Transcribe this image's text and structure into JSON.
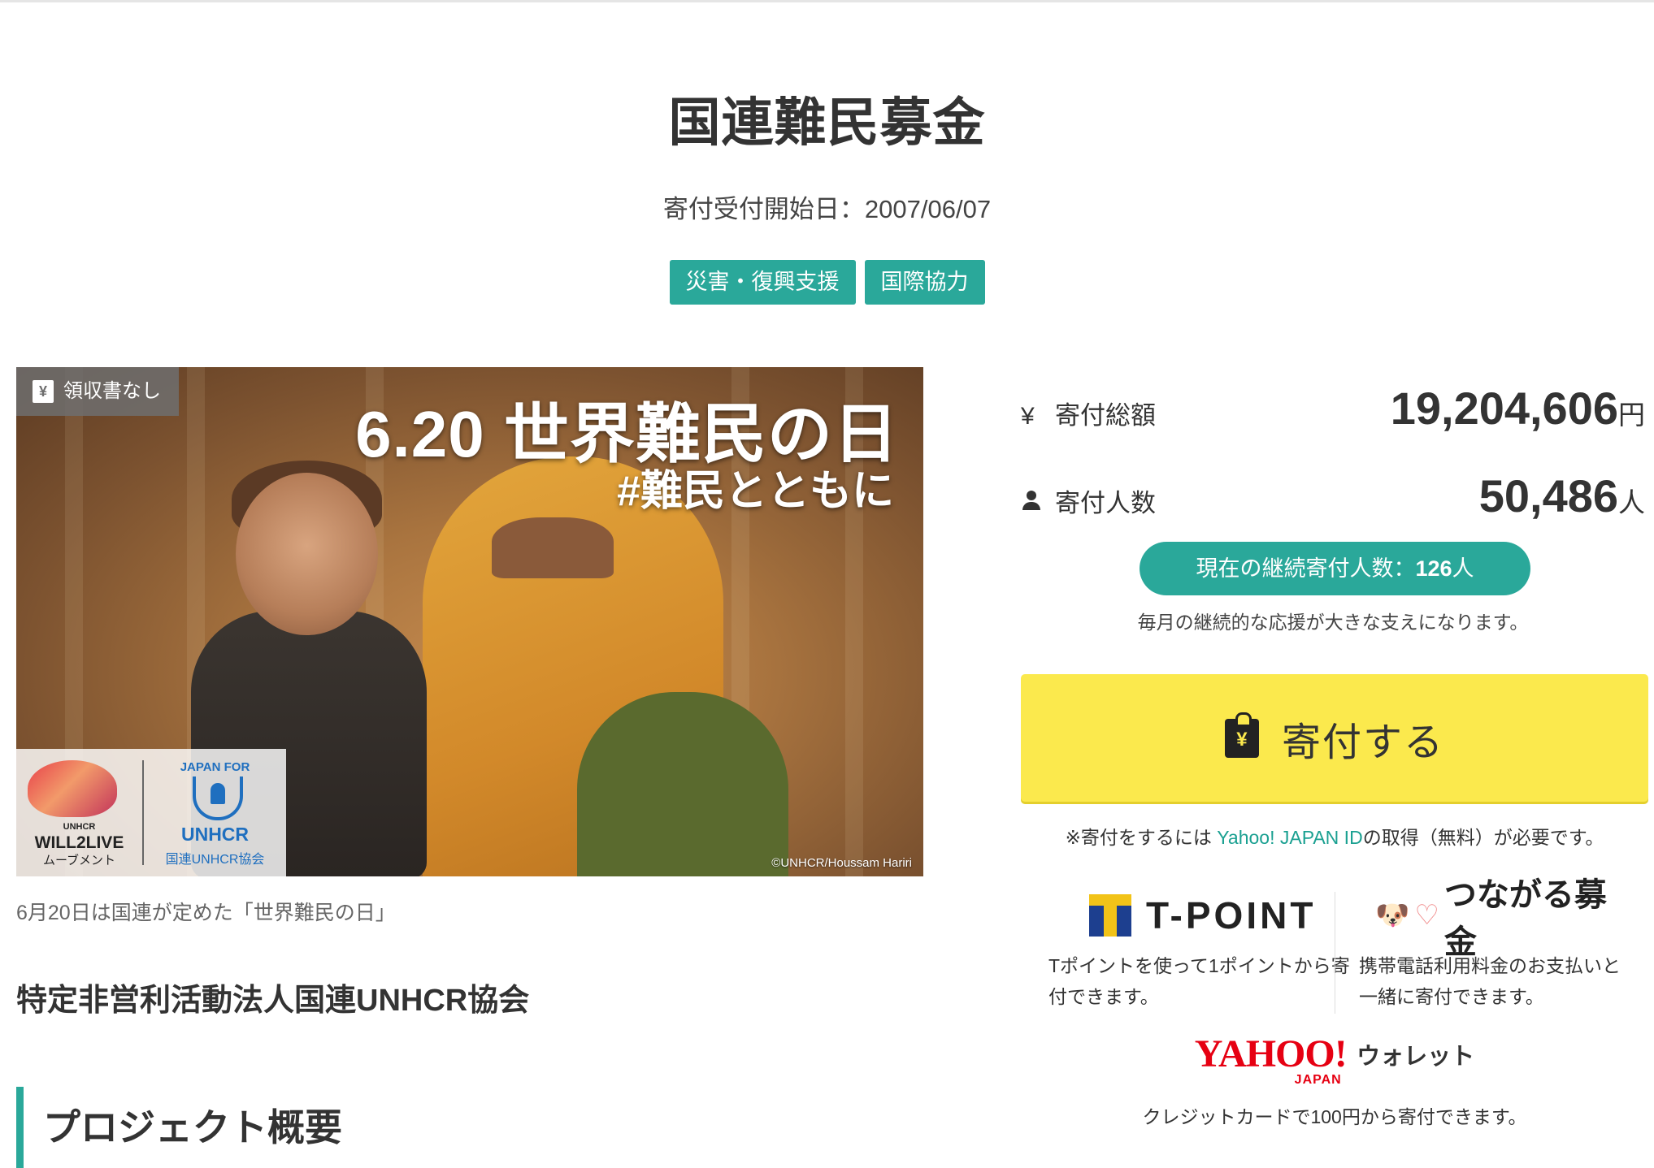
{
  "page": {
    "title": "国連難民募金",
    "start_date": "寄付受付開始日：2007/06/07",
    "tags": [
      "災害・復興支援",
      "国際協力"
    ]
  },
  "hero": {
    "badge_icon": "yen-receipt-icon",
    "badge_symbol": "¥",
    "badge_label": "領収書なし",
    "heading": "6.20 世界難民の日",
    "hashtag": "#難民とともに",
    "credit": "©UNHCR/Houssam Hariri",
    "logo_will_top": "UNHCR",
    "logo_will_name": "WILL2LIVE",
    "logo_will_sub": "ムーブメント",
    "logo_unhcr_top": "JAPAN FOR",
    "logo_unhcr_name": "UNHCR",
    "logo_unhcr_sub": "国連UNHCR協会",
    "caption": "6月20日は国連が定めた「世界難民の日」"
  },
  "org": {
    "name": "特定非営利活動法人国連UNHCR協会"
  },
  "section": {
    "overview_title": "プロジェクト概要"
  },
  "stats": {
    "total_icon": "yen-icon",
    "total_symbol": "¥",
    "total_label": "寄付総額",
    "total_value": "19,204,606",
    "total_unit": "円",
    "donors_icon": "person-icon",
    "donors_label": "寄付人数",
    "donors_value": "50,486",
    "donors_unit": "人",
    "monthly_label": "現在の継続寄付人数：",
    "monthly_value": "126",
    "monthly_unit": "人",
    "monthly_note": "毎月の継続的な応援が大きな支えになります。"
  },
  "donate": {
    "icon": "donation-clipboard-icon",
    "symbol": "¥",
    "label": "寄付する",
    "note_prefix": "※寄付をするには ",
    "note_link": "Yahoo! JAPAN ID",
    "note_suffix": "の取得（無料）が必要です。"
  },
  "payments": {
    "tpoint_logo": "T-POINT",
    "tpoint_desc": "Tポイントを使って1ポイントから寄付できます。",
    "tsunagaru_logo": "つながる募金",
    "tsunagaru_desc": "携帯電話利用料金のお支払いと一緒に寄付できます。",
    "yahoo_logo": "YAHOO!",
    "yahoo_logo_sub": "JAPAN",
    "yahoo_wallet": "ウォレット",
    "yahoo_desc": "クレジットカードで100円から寄付できます。"
  },
  "colors": {
    "accent": "#2aa89a",
    "donate_button": "#fbe94d",
    "link": "#1aa091",
    "yahoo_red": "#e60012",
    "tpoint_blue": "#1d3f8f",
    "tpoint_yellow": "#f2c318"
  }
}
